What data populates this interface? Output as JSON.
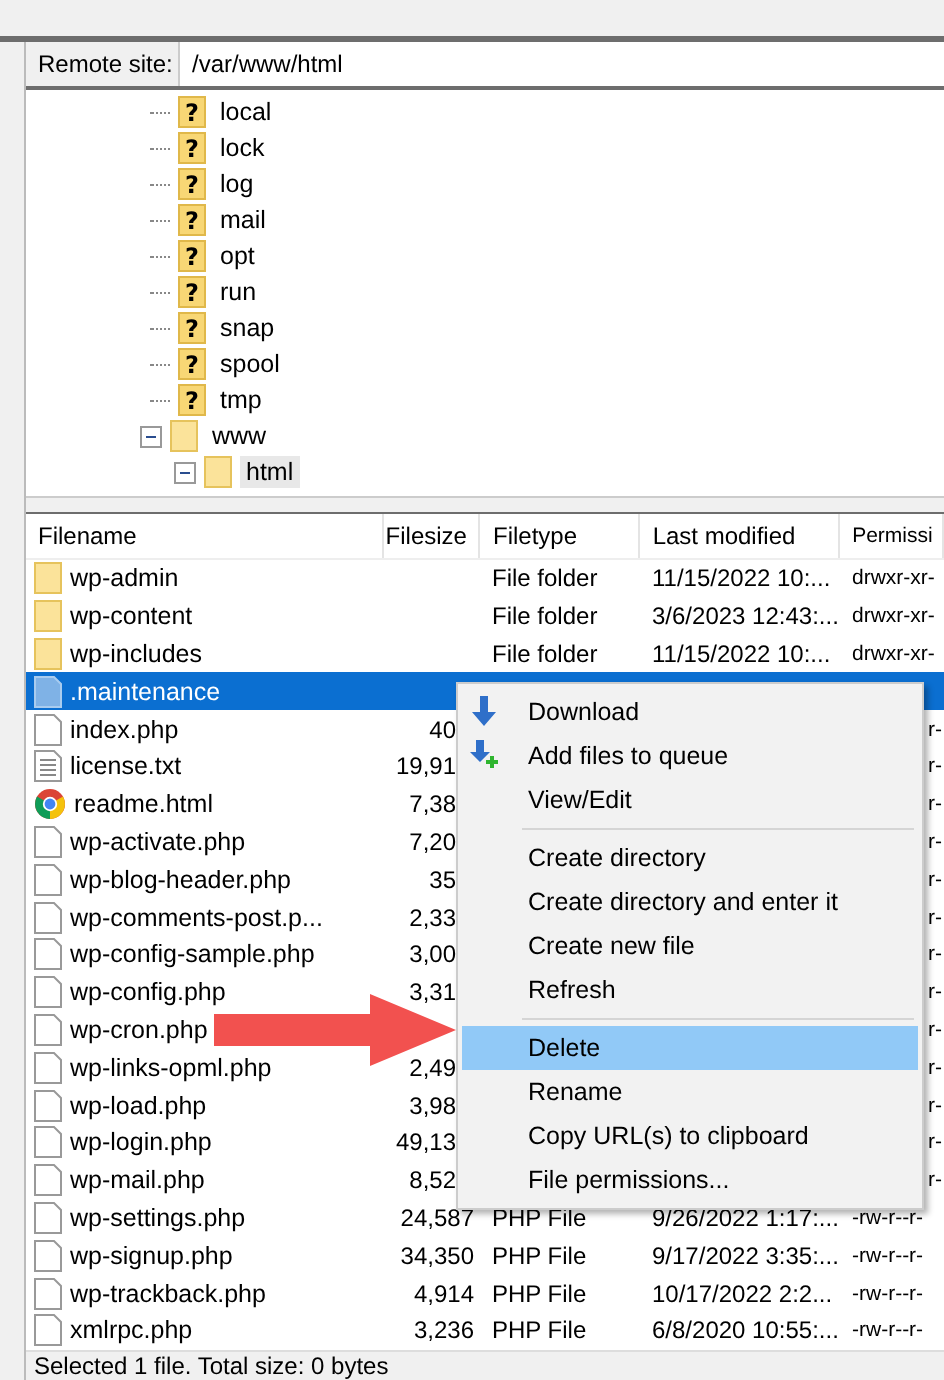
{
  "remote_site": {
    "label": "Remote site:",
    "path": "/var/www/html"
  },
  "tree": [
    {
      "name": "local",
      "kind": "unknown",
      "glyph": "?",
      "selected": false
    },
    {
      "name": "lock",
      "kind": "unknown",
      "glyph": "?",
      "selected": false
    },
    {
      "name": "log",
      "kind": "unknown",
      "glyph": "?",
      "selected": false
    },
    {
      "name": "mail",
      "kind": "unknown",
      "glyph": "?",
      "selected": false
    },
    {
      "name": "opt",
      "kind": "unknown",
      "glyph": "?",
      "selected": false
    },
    {
      "name": "run",
      "kind": "unknown",
      "glyph": "?",
      "selected": false
    },
    {
      "name": "snap",
      "kind": "unknown",
      "glyph": "?",
      "selected": false
    },
    {
      "name": "spool",
      "kind": "unknown",
      "glyph": "?",
      "selected": false
    },
    {
      "name": "tmp",
      "kind": "unknown",
      "glyph": "?",
      "selected": false
    },
    {
      "name": "www",
      "kind": "folder",
      "expanded": true,
      "selected": false,
      "children": [
        {
          "name": "html",
          "kind": "folder",
          "expanded": true,
          "selected": true
        }
      ]
    }
  ],
  "table": {
    "columns": [
      "Filename",
      "Filesize",
      "Filetype",
      "Last modified",
      "Permissi"
    ],
    "rows": [
      {
        "name": "wp-admin",
        "kind": "folder",
        "selected": false,
        "filetype": "File folder",
        "modified": "11/15/2022 10:...",
        "perm": "drwxr-xr-"
      },
      {
        "name": "wp-content",
        "kind": "folder",
        "selected": false,
        "filetype": "File folder",
        "modified": "3/6/2023 12:43:...",
        "perm": "drwxr-xr-"
      },
      {
        "name": "wp-includes",
        "kind": "folder",
        "selected": false,
        "filetype": "File folder",
        "modified": "11/15/2022 10:...",
        "perm": "drwxr-xr-"
      },
      {
        "name": ".maintenance",
        "kind": "file",
        "selected": true
      },
      {
        "name": "index.php",
        "kind": "file",
        "selected": false,
        "size": "40",
        "perm": "r-"
      },
      {
        "name": "license.txt",
        "kind": "text",
        "selected": false,
        "size": "19,91",
        "perm": "r-"
      },
      {
        "name": "readme.html",
        "kind": "web",
        "selected": false,
        "size": "7,38",
        "perm": "r-"
      },
      {
        "name": "wp-activate.php",
        "kind": "file",
        "selected": false,
        "size": "7,20",
        "perm": "r-"
      },
      {
        "name": "wp-blog-header.php",
        "kind": "file",
        "selected": false,
        "size": "35",
        "perm": "r-"
      },
      {
        "name": "wp-comments-post.p...",
        "kind": "file",
        "selected": false,
        "size": "2,33",
        "perm": "r-"
      },
      {
        "name": "wp-config-sample.php",
        "kind": "file",
        "selected": false,
        "size": "3,00",
        "perm": "r-"
      },
      {
        "name": "wp-config.php",
        "kind": "file",
        "selected": false,
        "size": "3,31",
        "perm": "r-"
      },
      {
        "name": "wp-cron.php",
        "kind": "file",
        "selected": false,
        "perm": "r-"
      },
      {
        "name": "wp-links-opml.php",
        "kind": "file",
        "selected": false,
        "size": "2,49",
        "perm": "r-"
      },
      {
        "name": "wp-load.php",
        "kind": "file",
        "selected": false,
        "size": "3,98",
        "perm": "r-"
      },
      {
        "name": "wp-login.php",
        "kind": "file",
        "selected": false,
        "size": "49,13",
        "perm": "r-"
      },
      {
        "name": "wp-mail.php",
        "kind": "file",
        "selected": false,
        "size": "8,52",
        "perm": "r-"
      },
      {
        "name": "wp-settings.php",
        "kind": "file",
        "selected": false,
        "size": "24,587",
        "filetype": "PHP File",
        "modified": "9/26/2022 1:17:...",
        "perm": "-rw-r--r-"
      },
      {
        "name": "wp-signup.php",
        "kind": "file",
        "selected": false,
        "size": "34,350",
        "filetype": "PHP File",
        "modified": "9/17/2022 3:35:...",
        "perm": "-rw-r--r-"
      },
      {
        "name": "wp-trackback.php",
        "kind": "file",
        "selected": false,
        "size": "4,914",
        "filetype": "PHP File",
        "modified": "10/17/2022 2:2...",
        "perm": "-rw-r--r-"
      },
      {
        "name": "xmlrpc.php",
        "kind": "file",
        "selected": false,
        "size": "3,236",
        "filetype": "PHP File",
        "modified": "6/8/2020 10:55:...",
        "perm": "-rw-r--r-"
      }
    ]
  },
  "context_menu": {
    "groups": [
      [
        {
          "label": "Download",
          "kind": "download",
          "selected": false
        },
        {
          "label": "Add files to queue",
          "kind": "queue",
          "selected": false
        },
        {
          "label": "View/Edit",
          "kind": "plain",
          "selected": false
        }
      ],
      [
        {
          "label": "Create directory",
          "kind": "plain",
          "selected": false
        },
        {
          "label": "Create directory and enter it",
          "kind": "plain",
          "selected": false
        },
        {
          "label": "Create new file",
          "kind": "plain",
          "selected": false
        },
        {
          "label": "Refresh",
          "kind": "plain",
          "selected": false
        }
      ],
      [
        {
          "label": "Delete",
          "kind": "plain",
          "selected": true
        },
        {
          "label": "Rename",
          "kind": "plain",
          "selected": false
        },
        {
          "label": "Copy URL(s) to clipboard",
          "kind": "plain",
          "selected": false
        },
        {
          "label": "File permissions...",
          "kind": "plain",
          "selected": false
        }
      ]
    ]
  },
  "status_bar": "Selected 1 file. Total size: 0 bytes"
}
